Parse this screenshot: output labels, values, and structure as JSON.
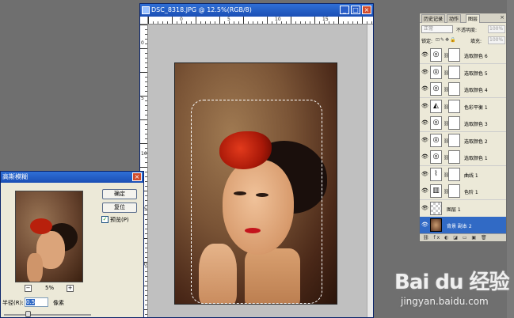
{
  "document": {
    "title": "DSC_8318.JPG @ 12.5%(RGB/8)",
    "ruler_top_numbers": [
      "0",
      "5",
      "10",
      "15"
    ],
    "ruler_left_numbers": [
      "0",
      "5",
      "10",
      "15",
      "20"
    ]
  },
  "dialog": {
    "title": "高斯模糊",
    "ok_label": "确定",
    "reset_label": "复位",
    "preview_label": "预览(P)",
    "preview_checked": "✓",
    "zoom_out": "−",
    "zoom_in": "+",
    "zoom_value": "5%",
    "radius_label": "半径(R):",
    "radius_value": "0.5",
    "radius_unit": "像素",
    "slider_position": 0.27
  },
  "panel": {
    "tabs": [
      "历史记录",
      "动作",
      "图层"
    ],
    "close": "×",
    "blend_mode": "正常",
    "opacity_label": "不透明度:",
    "opacity_value": "100%",
    "lock_label": "锁定:",
    "lock_icons": "⊡✎✥🔒",
    "fill_label": "填充:",
    "fill_value": "100%",
    "footer_icons": "⛓ fx ◐ ◪ ▭ ▣ 🗑",
    "layers": [
      {
        "name": "选取颜色 6",
        "thumb": "adjust",
        "selected": false
      },
      {
        "name": "选取颜色 5",
        "thumb": "adjust",
        "selected": false
      },
      {
        "name": "选取颜色 4",
        "thumb": "adjust",
        "selected": false
      },
      {
        "name": "色彩平衡 1",
        "thumb": "balance",
        "selected": false
      },
      {
        "name": "选取颜色 3",
        "thumb": "adjust",
        "selected": false
      },
      {
        "name": "选取颜色 2",
        "thumb": "adjust",
        "selected": false
      },
      {
        "name": "选取颜色 1",
        "thumb": "adjust",
        "selected": false
      },
      {
        "name": "曲线 1",
        "thumb": "curves",
        "selected": false
      },
      {
        "name": "色阶 1",
        "thumb": "levels",
        "selected": false
      },
      {
        "name": "图层 1",
        "thumb": "transparent",
        "selected": false
      },
      {
        "name": "背景 副本 2",
        "thumb": "photo",
        "selected": true
      }
    ]
  },
  "watermark": {
    "logo": "Bai du 经验",
    "url": "jingyan.baidu.com"
  },
  "colors": {
    "titlebar": "#1b4fb5",
    "selection": "#316ac5",
    "close": "#d24c2c"
  }
}
